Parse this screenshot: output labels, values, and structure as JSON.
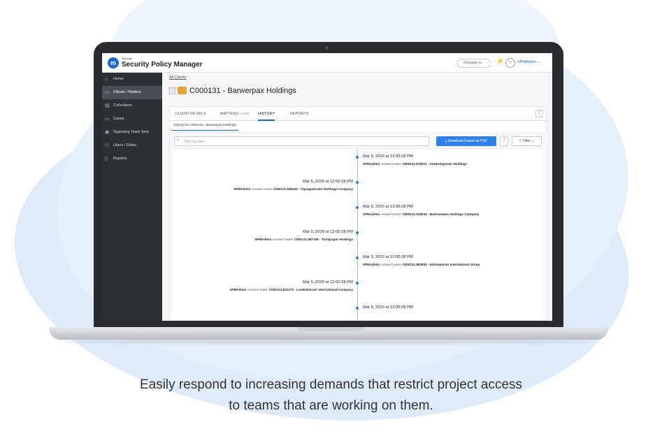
{
  "app": {
    "logo_letter": "m",
    "brand_small": "iManage",
    "brand_title": "Security Policy Manager"
  },
  "header": {
    "navigate_placeholder": "Navigate to...",
    "user_name": "SPMAdmin",
    "user_chevron": "⌄"
  },
  "sidebar": {
    "items": [
      {
        "label": "Home",
        "icon": "⌂"
      },
      {
        "label": "Clients / Matters",
        "icon": "▭"
      },
      {
        "label": "Collections",
        "icon": "▤"
      },
      {
        "label": "Cases",
        "icon": "▭"
      },
      {
        "label": "Opposing Team Sets",
        "icon": "◉"
      },
      {
        "label": "Users / Roles",
        "icon": "⚇"
      },
      {
        "label": "Reports",
        "icon": "▯"
      }
    ]
  },
  "main": {
    "breadcrumb": "All Clients",
    "title": "C000131 - Barwerpax Holdings",
    "tabs": [
      {
        "label": "CLIENT DETAILS",
        "count": ""
      },
      {
        "label": "MATTERS",
        "count": "(2,569)"
      },
      {
        "label": "HISTORY",
        "count": ""
      },
      {
        "label": "REPORTS",
        "count": ""
      }
    ],
    "subtab": "History for C000131 - Barwerpax Holdings",
    "search_placeholder": "Filter by User",
    "download_label": "Download Report as PDF",
    "filter_label": "Filter",
    "kebab": "⋮"
  },
  "history": [
    {
      "side": "right",
      "time": "Mar 5, 2020 at 12:00:28 PM",
      "user": "SPMAdmin",
      "action": "created matter",
      "matter": "C000131.975021 - Zeedudepower Holdings"
    },
    {
      "side": "left",
      "time": "Mar 5, 2020 at 12:00:28 PM",
      "user": "SPMAdmin",
      "action": "created matter",
      "matter": "C000131.948042 - Cipsapolicator Holdings Company"
    },
    {
      "side": "right",
      "time": "Mar 5, 2020 at 12:00:28 PM",
      "user": "SPMAdmin",
      "action": "created matter",
      "matter": "C000131.915033 - Bartumewex Holdings Company"
    },
    {
      "side": "left",
      "time": "Mar 5, 2020 at 12:00:28 PM",
      "user": "SPMAdmin",
      "action": "created matter",
      "matter": "C000131.897199 - Trunipopor Holdings"
    },
    {
      "side": "right",
      "time": "Mar 5, 2020 at 12:00:28 PM",
      "user": "SPMAdmin",
      "action": "created matter",
      "matter": "C000131.883832 - Endsaponan International Group"
    },
    {
      "side": "left",
      "time": "Mar 5, 2020 at 12:00:28 PM",
      "user": "SPMAdmin",
      "action": "created matter",
      "matter": "C000131.831273 - Lomkiledover International Company"
    },
    {
      "side": "right",
      "time": "Mar 5, 2020 at 12:00:28 PM",
      "user": "",
      "action": "",
      "matter": ""
    }
  ],
  "caption": {
    "line1": "Easily respond to increasing demands that restrict project access",
    "line2": "to teams that are working on them."
  },
  "colors": {
    "accent": "#2f80ed",
    "sidebar": "#2d3136",
    "folder": "#e3a336"
  }
}
